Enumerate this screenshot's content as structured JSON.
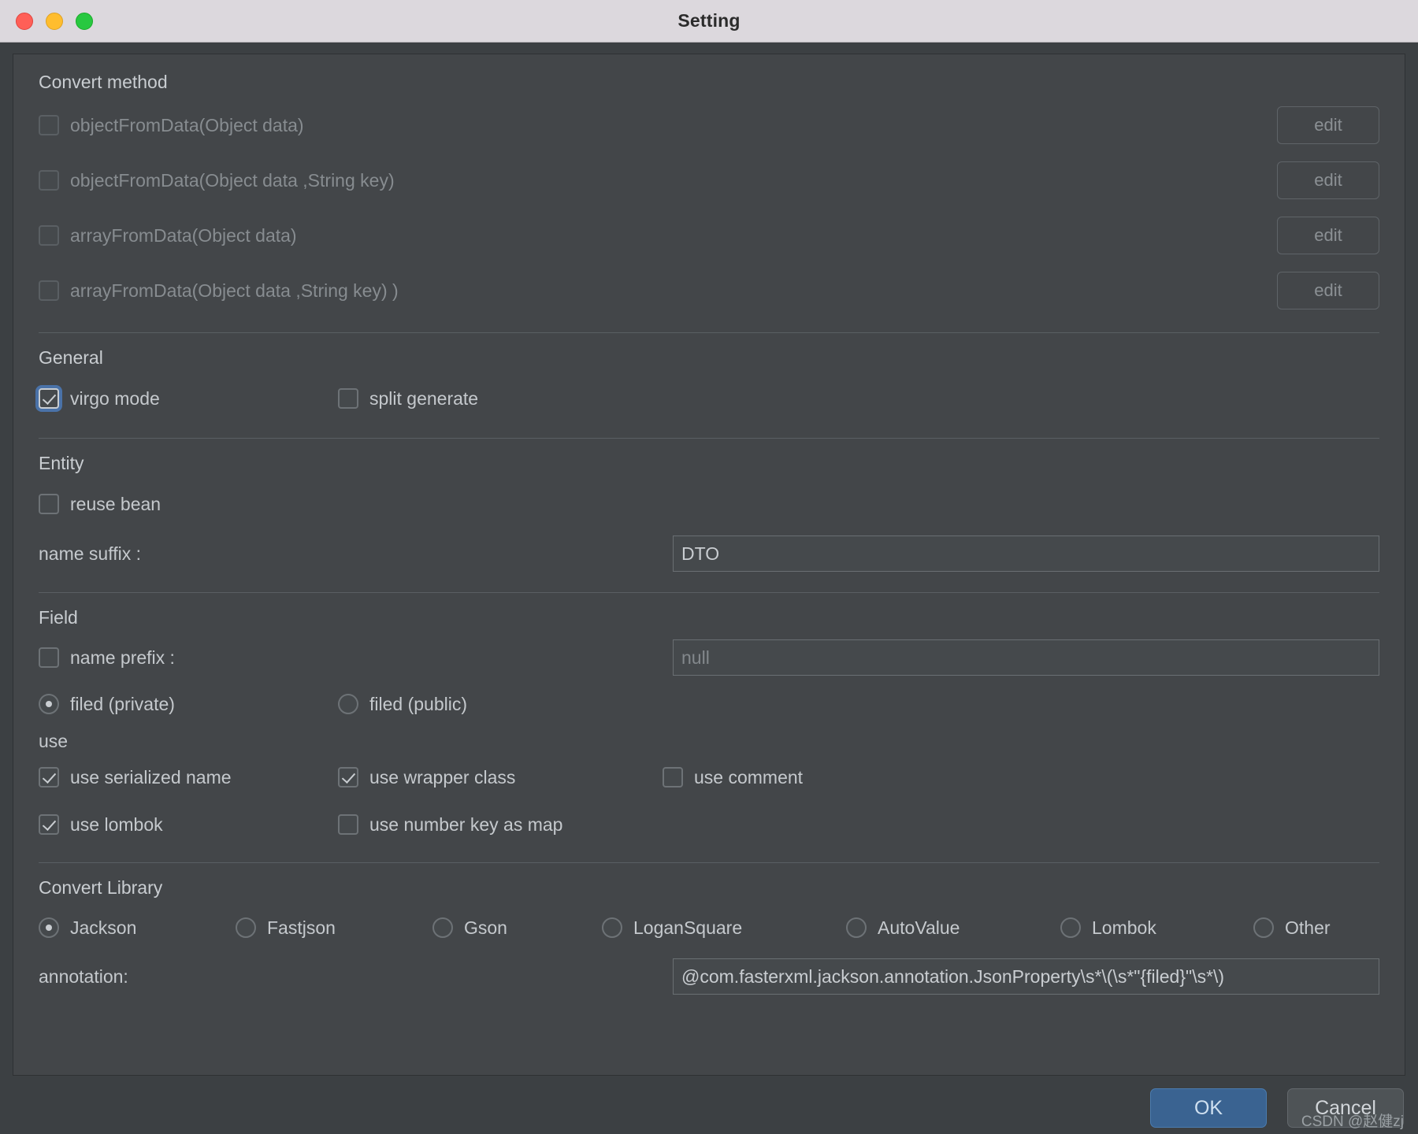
{
  "window": {
    "title": "Setting",
    "traffic_lights": [
      "close-button",
      "minimize-button",
      "zoom-button"
    ]
  },
  "convert_method": {
    "heading": "Convert method",
    "items": [
      {
        "label": "objectFromData(Object data)",
        "checked": false,
        "disabled": true,
        "edit_label": "edit"
      },
      {
        "label": "objectFromData(Object data ,String key)",
        "checked": false,
        "disabled": true,
        "edit_label": "edit"
      },
      {
        "label": "arrayFromData(Object data)",
        "checked": false,
        "disabled": true,
        "edit_label": "edit"
      },
      {
        "label": "arrayFromData(Object data ,String key) )",
        "checked": false,
        "disabled": true,
        "edit_label": "edit"
      }
    ]
  },
  "general": {
    "heading": "General",
    "items": [
      {
        "label": "virgo mode",
        "checked": true,
        "focused": true
      },
      {
        "label": "split generate",
        "checked": false,
        "focused": false
      }
    ]
  },
  "entity": {
    "heading": "Entity",
    "reuse_bean": {
      "label": "reuse bean",
      "checked": false
    },
    "name_suffix": {
      "label": "name suffix :",
      "value": "DTO",
      "placeholder": ""
    }
  },
  "field": {
    "heading": "Field",
    "name_prefix": {
      "label": "name prefix :",
      "checked": false,
      "value": "",
      "placeholder": "null"
    },
    "visibility": {
      "options": [
        {
          "label": "filed (private)",
          "selected": true
        },
        {
          "label": "filed (public)",
          "selected": false
        }
      ]
    },
    "use_heading": "use",
    "use_options": [
      {
        "label": "use serialized name",
        "checked": true
      },
      {
        "label": "use wrapper class",
        "checked": true
      },
      {
        "label": "use comment",
        "checked": false
      },
      {
        "label": "use lombok",
        "checked": true
      },
      {
        "label": "use number key as map",
        "checked": false
      }
    ]
  },
  "convert_library": {
    "heading": "Convert Library",
    "options": [
      {
        "label": "Jackson",
        "selected": true
      },
      {
        "label": "Fastjson",
        "selected": false
      },
      {
        "label": "Gson",
        "selected": false
      },
      {
        "label": "LoganSquare",
        "selected": false
      },
      {
        "label": "AutoValue",
        "selected": false
      },
      {
        "label": "Lombok",
        "selected": false
      },
      {
        "label": "Other",
        "selected": false
      }
    ],
    "annotation": {
      "label": "annotation:",
      "value": "@com.fasterxml.jackson.annotation.JsonProperty\\s*\\(\\s*\"{filed}\"\\s*\\)",
      "placeholder": ""
    }
  },
  "footer": {
    "ok_label": "OK",
    "cancel_label": "Cancel",
    "watermark": "CSDN @赵健zj"
  },
  "colors": {
    "accent": "#3a6391",
    "focus_ring": "#4a72a8",
    "panel_bg": "#434649",
    "titlebar_bg": "#dcd8dd"
  }
}
